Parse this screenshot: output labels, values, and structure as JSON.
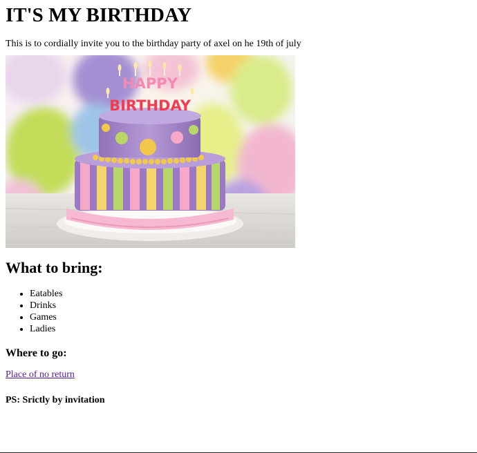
{
  "title": "IT'S MY BIRTHDAY",
  "intro": "This is to cordially invite you to the birthday party of axel on he 19th of july",
  "image": {
    "alt": "Birthday cake",
    "topper_line1": "HAPPY",
    "topper_line2": "BIRTHDAY"
  },
  "bring": {
    "heading": "What to bring:",
    "items": [
      "Eatables",
      "Drinks",
      "Games",
      "Ladies"
    ]
  },
  "where": {
    "heading": "Where to go:",
    "link_text": "Place of no return"
  },
  "ps": "PS: Srictly by invitation",
  "colors": {
    "link": "#551a8b",
    "text": "#000000",
    "background": "#ffffff"
  }
}
